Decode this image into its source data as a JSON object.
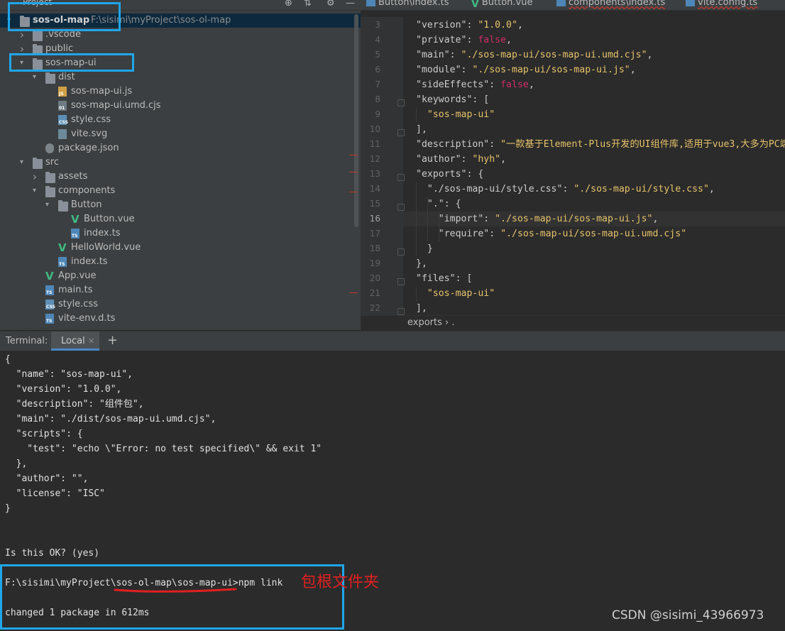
{
  "project_panel": {
    "title": "Project",
    "tree": [
      {
        "label": "sos-ol-map",
        "path": "F:\\sisimi\\myProject\\sos-ol-map",
        "type": "folder",
        "depth": 0,
        "expanded": true,
        "bold": true
      },
      {
        "label": ".vscode",
        "type": "folder",
        "depth": 1,
        "expanded": false
      },
      {
        "label": "public",
        "type": "folder",
        "depth": 1,
        "expanded": false
      },
      {
        "label": "sos-map-ui",
        "type": "folder",
        "depth": 1,
        "expanded": true
      },
      {
        "label": "dist",
        "type": "folder",
        "depth": 2,
        "expanded": true
      },
      {
        "label": "sos-map-ui.js",
        "type": "js",
        "depth": 3
      },
      {
        "label": "sos-map-ui.umd.cjs",
        "type": "bin",
        "depth": 3
      },
      {
        "label": "style.css",
        "type": "css",
        "depth": 3
      },
      {
        "label": "vite.svg",
        "type": "svg",
        "depth": 3
      },
      {
        "label": "package.json",
        "type": "json",
        "depth": 2
      },
      {
        "label": "src",
        "type": "folder",
        "depth": 1,
        "expanded": true
      },
      {
        "label": "assets",
        "type": "folder",
        "depth": 2,
        "expanded": false
      },
      {
        "label": "components",
        "type": "folder",
        "depth": 2,
        "expanded": true
      },
      {
        "label": "Button",
        "type": "folder",
        "depth": 3,
        "expanded": true
      },
      {
        "label": "Button.vue",
        "type": "vue",
        "depth": 4
      },
      {
        "label": "index.ts",
        "type": "ts",
        "depth": 4
      },
      {
        "label": "HelloWorld.vue",
        "type": "vue",
        "depth": 3
      },
      {
        "label": "index.ts",
        "type": "ts",
        "depth": 3
      },
      {
        "label": "App.vue",
        "type": "vue",
        "depth": 2
      },
      {
        "label": "main.ts",
        "type": "ts",
        "depth": 2
      },
      {
        "label": "style.css",
        "type": "css",
        "depth": 2
      },
      {
        "label": "vite-env.d.ts",
        "type": "ts",
        "depth": 2
      }
    ]
  },
  "editor": {
    "tabs": [
      {
        "label": "Button\\index.ts",
        "icon": "ts"
      },
      {
        "label": "Button.vue",
        "icon": "vue"
      },
      {
        "label": "components\\index.ts",
        "icon": "ts"
      },
      {
        "label": "vite.config.ts",
        "icon": "ts"
      }
    ],
    "line_numbers": [
      "3",
      "4",
      "5",
      "6",
      "7",
      "8",
      "9",
      "10",
      "11",
      "12",
      "13",
      "14",
      "15",
      "16",
      "17",
      "18",
      "19",
      "20",
      "21",
      "22"
    ],
    "current_line": "16",
    "code": {
      "l3_key": "\"version\"",
      "l3_val": "\"1.0.0\"",
      "l4_key": "\"private\"",
      "l4_val": "false",
      "l5_key": "\"main\"",
      "l5_val": "\"./sos-map-ui/sos-map-ui.umd.cjs\"",
      "l6_key": "\"module\"",
      "l6_val": "\"./sos-map-ui/sos-map-ui.js\"",
      "l7_key": "\"sideEffects\"",
      "l7_val": "false",
      "l8_key": "\"keywords\"",
      "l9_val": "\"sos-map-ui\"",
      "l11_key": "\"description\"",
      "l11_val": "\"一款基于Element-Plus开发的UI组件库,适用于vue3,大多为PC端",
      "l12_key": "\"author\"",
      "l12_val": "\"hyh\"",
      "l13_key": "\"exports\"",
      "l14_key": "\"./sos-map-ui/style.css\"",
      "l14_val": "\"./sos-map-ui/style.css\"",
      "l15_key": "\".\"",
      "l16_key": "\"import\"",
      "l16_val": "\"./sos-map-ui/sos-map-ui.js\"",
      "l17_key": "\"require\"",
      "l17_val": "\"./sos-map-ui/sos-map-ui.umd.cjs\"",
      "l20_key": "\"files\"",
      "l21_val": "\"sos-map-ui\""
    },
    "breadcrumb": "exports  ›  ."
  },
  "terminal": {
    "title": "Terminal:",
    "tab": "Local",
    "lines": [
      "{",
      "  \"name\": \"sos-map-ui\",",
      "  \"version\": \"1.0.0\",",
      "  \"description\": \"组件包\",",
      "  \"main\": \"./dist/sos-map-ui.umd.cjs\",",
      "  \"scripts\": {",
      "    \"test\": \"echo \\\"Error: no test specified\\\" && exit 1\"",
      "  },",
      "  \"author\": \"\",",
      "  \"license\": \"ISC\"",
      "}"
    ],
    "confirm": "Is this OK? (yes)",
    "prompt": "F:\\sisimi\\myProject\\sos-ol-map\\sos-map-ui>npm link",
    "result": "changed 1 package in 612ms"
  },
  "annotation_note": "包根文件夹",
  "watermark": "CSDN @sisimi_43966973",
  "colors": {
    "highlight_box": "#1fa6ea",
    "note_red": "#e02020",
    "keyword": "#cbcbcb",
    "string": "#e6c36b",
    "boolean": "#cc2d67"
  }
}
